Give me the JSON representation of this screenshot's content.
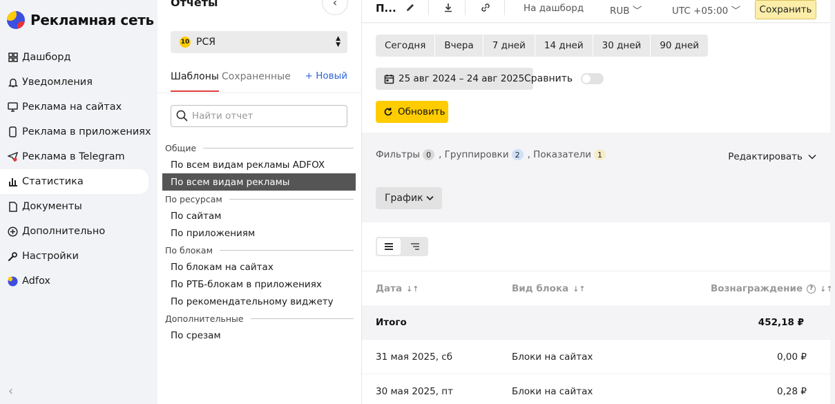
{
  "brand": {
    "name": "Рекламная сеть"
  },
  "nav": {
    "items": [
      {
        "label": "Дашборд",
        "icon": "grid-icon"
      },
      {
        "label": "Уведомления",
        "icon": "bell-icon"
      },
      {
        "label": "Реклама на сайтах",
        "icon": "monitor-icon"
      },
      {
        "label": "Реклама в приложениях",
        "icon": "phone-icon"
      },
      {
        "label": "Реклама в Telegram",
        "icon": "telegram-icon"
      },
      {
        "label": "Статистика",
        "icon": "chart-icon",
        "active": true
      },
      {
        "label": "Документы",
        "icon": "document-icon"
      },
      {
        "label": "Дополнительно",
        "icon": "plus-circle-icon"
      },
      {
        "label": "Настройки",
        "icon": "wrench-icon"
      },
      {
        "label": "Adfox",
        "icon": "adfox-icon"
      }
    ],
    "collapse_glyph": "‹"
  },
  "reports": {
    "title": "Отчеты",
    "collapse_glyph": "‹",
    "source_select": {
      "badge": "10",
      "value": "РСЯ"
    },
    "tabs": {
      "templates": "Шаблоны",
      "saved": "Сохраненные",
      "new": "+ Новый"
    },
    "search_placeholder": "Найти отчет",
    "groups": [
      {
        "title": "Общие",
        "items": [
          "По всем видам рекламы ADFOX",
          "По всем видам рекламы"
        ]
      },
      {
        "title": "По ресурсам",
        "items": [
          "По сайтам",
          "По приложениям"
        ]
      },
      {
        "title": "По блокам",
        "items": [
          "По блокам на сайтах",
          "По РТБ-блокам в приложениях",
          "По рекомендательному виджету"
        ]
      },
      {
        "title": "Дополнительные",
        "items": [
          "По срезам"
        ]
      }
    ],
    "active_item": "По всем видам рекламы"
  },
  "topbar": {
    "report_name": "П...",
    "dashboard": "На дашборд",
    "currency": "RUB",
    "timezone": "UTC +05:00",
    "save": "Сохранить"
  },
  "period": {
    "presets": [
      "Сегодня",
      "Вчера",
      "7 дней",
      "14 дней",
      "30 дней",
      "90 дней"
    ],
    "range": "25 авг 2024 – 24 авг 2025",
    "compare": "Сравнить",
    "compare_on": false,
    "refresh": "Обновить"
  },
  "filters": {
    "filters_label": "Фильтры",
    "filters_count": "0",
    "groupings_label": ", Группировки",
    "groupings_count": "2",
    "metrics_label": ", Показатели",
    "metrics_count": "1",
    "edit": "Редактировать"
  },
  "view": {
    "chart_button": "График"
  },
  "table": {
    "columns": [
      "Дата",
      "Вид блока",
      "Вознаграждение"
    ],
    "sort_glyph": "↓↑",
    "help_glyph": "?",
    "total": {
      "label": "Итого",
      "value": "452,18 ₽"
    },
    "rows": [
      {
        "date": "31 мая 2025, сб",
        "block": "Блоки на сайтах",
        "reward": "0,00 ₽"
      },
      {
        "date": "30 мая 2025, пт",
        "block": "Блоки на сайтах",
        "reward": "0,28 ₽"
      }
    ]
  },
  "colors": {
    "accent": "#ffcc00",
    "active_item": "#555555",
    "link": "#2b63d9",
    "tab_underline": "#e23d3d"
  }
}
